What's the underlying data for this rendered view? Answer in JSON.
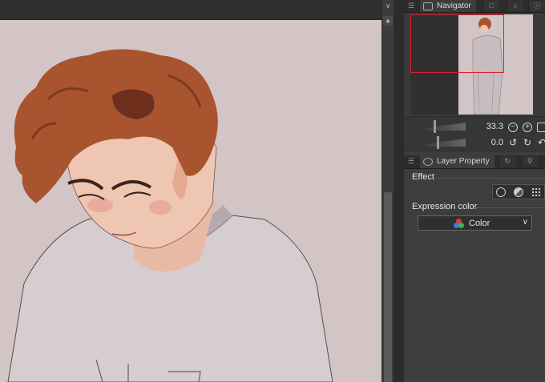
{
  "navigator": {
    "tab_label": "Navigator",
    "zoom_value": "33.3",
    "rotation_value": "0.0",
    "frame_color": "#e0202a"
  },
  "layer_property": {
    "tab_label": "Layer Property",
    "effect_label": "Effect",
    "expression_color_label": "Expression color",
    "expression_color_value": "Color"
  },
  "colors": {
    "canvas_bg": "#d3c5c6",
    "panel_bg": "#3d3d3d"
  }
}
